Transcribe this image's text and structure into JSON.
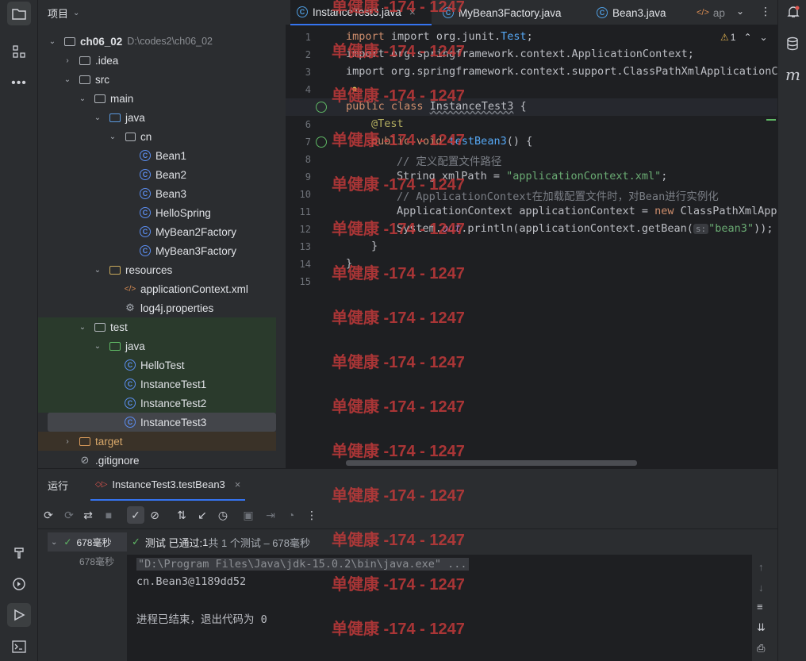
{
  "project_panel": {
    "title": "项目",
    "tree": [
      {
        "label": "ch06_02",
        "path": "D:\\codes2\\ch06_02",
        "type": "module",
        "indent": 0,
        "chev": "v"
      },
      {
        "label": ".idea",
        "type": "folder",
        "indent": 1,
        "chev": ">"
      },
      {
        "label": "src",
        "type": "folder",
        "indent": 1,
        "chev": "v"
      },
      {
        "label": "main",
        "type": "folder",
        "indent": 2,
        "chev": "v"
      },
      {
        "label": "java",
        "type": "folder-blue",
        "indent": 3,
        "chev": "v"
      },
      {
        "label": "cn",
        "type": "package",
        "indent": 4,
        "chev": "v"
      },
      {
        "label": "Bean1",
        "type": "class",
        "indent": 5,
        "chev": ""
      },
      {
        "label": "Bean2",
        "type": "class",
        "indent": 5,
        "chev": ""
      },
      {
        "label": "Bean3",
        "type": "class",
        "indent": 5,
        "chev": ""
      },
      {
        "label": "HelloSpring",
        "type": "class",
        "indent": 5,
        "chev": ""
      },
      {
        "label": "MyBean2Factory",
        "type": "class",
        "indent": 5,
        "chev": ""
      },
      {
        "label": "MyBean3Factory",
        "type": "class",
        "indent": 5,
        "chev": ""
      },
      {
        "label": "resources",
        "type": "folder-res",
        "indent": 3,
        "chev": "v"
      },
      {
        "label": "applicationContext.xml",
        "type": "xml",
        "indent": 4,
        "chev": ""
      },
      {
        "label": "log4j.properties",
        "type": "props",
        "indent": 4,
        "chev": ""
      },
      {
        "label": "test",
        "type": "folder",
        "indent": 2,
        "chev": "v"
      },
      {
        "label": "java",
        "type": "folder-green",
        "indent": 3,
        "chev": "v"
      },
      {
        "label": "HelloTest",
        "type": "test-class",
        "indent": 4,
        "chev": ""
      },
      {
        "label": "InstanceTest1",
        "type": "test-class",
        "indent": 4,
        "chev": ""
      },
      {
        "label": "InstanceTest2",
        "type": "test-class",
        "indent": 4,
        "chev": ""
      },
      {
        "label": "InstanceTest3",
        "type": "test-class",
        "indent": 4,
        "chev": "",
        "selected": true
      },
      {
        "label": "target",
        "type": "folder-orange",
        "indent": 1,
        "chev": ">"
      },
      {
        "label": ".gitignore",
        "type": "ignore",
        "indent": 1,
        "chev": ""
      }
    ]
  },
  "editor": {
    "tabs": [
      {
        "label": "InstanceTest3.java",
        "active": true,
        "closable": "×"
      },
      {
        "label": "MyBean3Factory.java",
        "active": false
      },
      {
        "label": "Bean3.java",
        "active": false
      },
      {
        "label": "ap",
        "active": false
      }
    ],
    "warning_count": "1",
    "line_numbers": [
      "1",
      "2",
      "3",
      "4",
      "5",
      "6",
      "7",
      "8",
      "9",
      "10",
      "11",
      "12",
      "13",
      "14",
      "15"
    ],
    "code": {
      "l1": [
        "import org.junit.",
        "Test",
        ";"
      ],
      "l2": "import org.springframework.context.ApplicationContext;",
      "l3": "import org.springframework.context.support.ClassPathXmlApplicationCo",
      "l5": [
        "public class ",
        "InstanceTest3",
        " {"
      ],
      "l6": "@Test",
      "l7": [
        "public void ",
        "testBean3",
        "() {"
      ],
      "l8": "// 定义配置文件路径",
      "l9": [
        "String xmlPath = ",
        "\"applicationContext.xml\"",
        ";"
      ],
      "l10": "// ApplicationContext在加载配置文件时，对Bean进行实例化",
      "l11": [
        "ApplicationContext applicationContext = ",
        "new",
        " ClassPathXmlAppl"
      ],
      "l12": [
        "System.",
        "out",
        ".println(applicationContext.getBean(",
        "s:",
        "\"bean3\"",
        "));"
      ],
      "l13": "}",
      "l14": "}"
    }
  },
  "run_panel": {
    "tab_label": "运行",
    "config_tab": "InstanceTest3.testBean3",
    "tree_root_time": "678毫秒",
    "tree_child_time": "678毫秒",
    "status": {
      "prefix": "测试 已通过: ",
      "count": "1",
      "rest": "共 1 个测试 – 678毫秒"
    },
    "console": [
      "\"D:\\Program Files\\Java\\jdk-15.0.2\\bin\\java.exe\" ...",
      "cn.Bean3@1189dd52",
      "",
      "进程已结束，退出代码为 0"
    ]
  },
  "watermark": "单健康 -174 - 1247",
  "colors": {
    "accent": "#3574f0",
    "pass": "#5fb865",
    "keyword": "#cf8e6d",
    "string": "#6aab73"
  }
}
